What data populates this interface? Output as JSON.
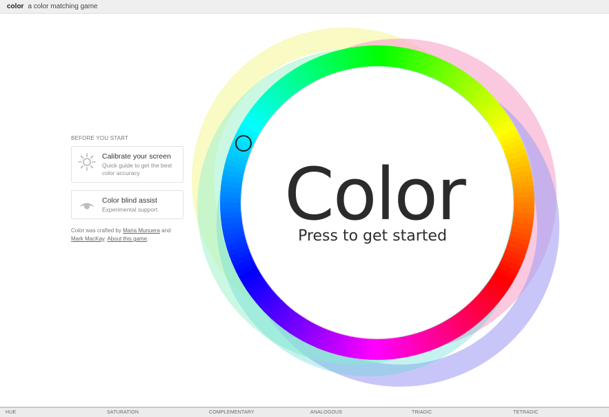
{
  "topbar": {
    "brand": "color",
    "tagline": "a color matching game"
  },
  "sidebar": {
    "section_label": "BEFORE YOU START",
    "cards": [
      {
        "title": "Calibrate your screen",
        "subtitle": "Quick guide to get the best color accuracy",
        "icon": "sun-icon"
      },
      {
        "title": "Color blind assist",
        "subtitle": "Experimental support",
        "icon": "eye-icon"
      }
    ],
    "credits": {
      "prefix": "Color was crafted by ",
      "author1": "Maria Munuera",
      "and": " and ",
      "author2": "Mark MacKay",
      "sep": ". ",
      "about": "About this game",
      "end": "."
    }
  },
  "main": {
    "title": "Color",
    "subtitle": "Press to get started"
  },
  "bottom_tabs": [
    "HUE",
    "SATURATION",
    "COMPLEMENTARY",
    "ANALOGOUS",
    "TRIADIC",
    "TETRADIC"
  ],
  "colors": {
    "ring_yellow": "#f6f7a4",
    "ring_pink": "#f7a6cc",
    "ring_violet": "#a7a3f3",
    "ring_mint": "#a6f3cf",
    "ring_teal": "#5ad7d6",
    "title_text": "#2b2b2b"
  }
}
